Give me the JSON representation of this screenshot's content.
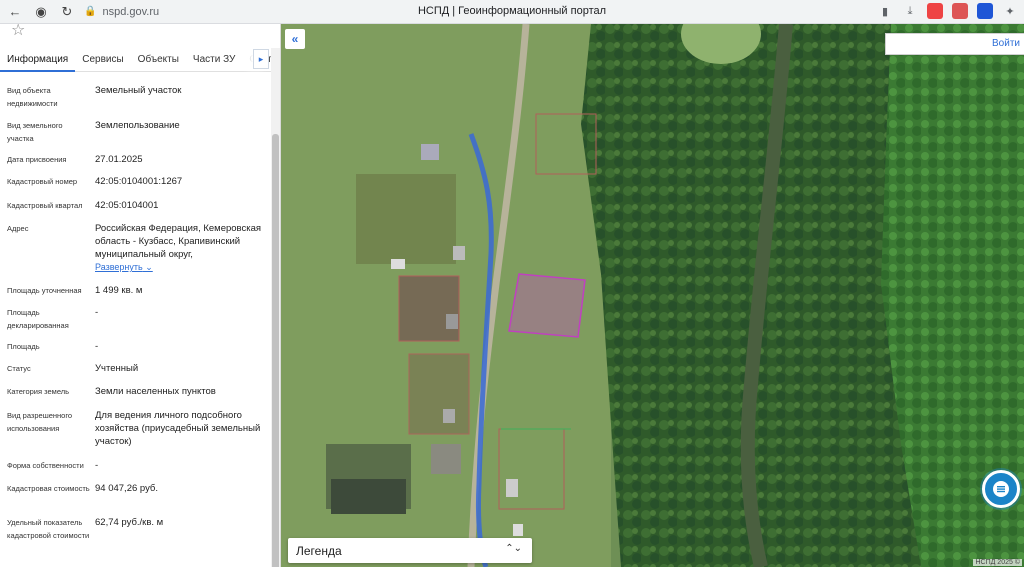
{
  "browser": {
    "url": "nspd.gov.ru",
    "title": "НСПД | Геоинформационный портал"
  },
  "panel": {
    "tabs": [
      "Информация",
      "Сервисы",
      "Объекты",
      "Части ЗУ",
      "Соста"
    ],
    "active_tab": "Информация",
    "rows": [
      {
        "label": "Вид объекта недвижимости",
        "value": "Земельный участок"
      },
      {
        "label": "Вид земельного участка",
        "value": "Землепользование"
      },
      {
        "label": "Дата присвоения",
        "value": "27.01.2025"
      },
      {
        "label": "Кадастровый номер",
        "value": "42:05:0104001:1267"
      },
      {
        "label": "Кадастровый квартал",
        "value": "42:05:0104001"
      },
      {
        "label": "Адрес",
        "value": "Российская Федерация, Кемеровская область - Кузбасс, Крапивинский муниципальный округ,"
      },
      {
        "label": "Площадь уточненная",
        "value": "1 499 кв. м"
      },
      {
        "label": "Площадь декларированная",
        "value": "-"
      },
      {
        "label": "Площадь",
        "value": "-"
      },
      {
        "label": "Статус",
        "value": "Учтенный"
      },
      {
        "label": "Категория земель",
        "value": "Земли населенных пунктов"
      },
      {
        "label": "Вид разрешенного использования",
        "value": "Для ведения личного подсобного хозяйства (приусадебный земельный участок)"
      },
      {
        "label": "Форма собственности",
        "value": "-"
      },
      {
        "label": "Кадастровая стоимость",
        "value": "94 047,26 руб."
      },
      {
        "label": "Удельный показатель кадастровой стоимости",
        "value": "62,74 руб./кв. м"
      }
    ],
    "expand_label": "Развернуть"
  },
  "map": {
    "login_label": "Войти",
    "legend_label": "Легенда",
    "attribution": "НСПД 2025 ©"
  },
  "colors": {
    "accent": "#2f6fd6",
    "parcel_outline": "#c040c0",
    "chat": "#1b84c8"
  }
}
